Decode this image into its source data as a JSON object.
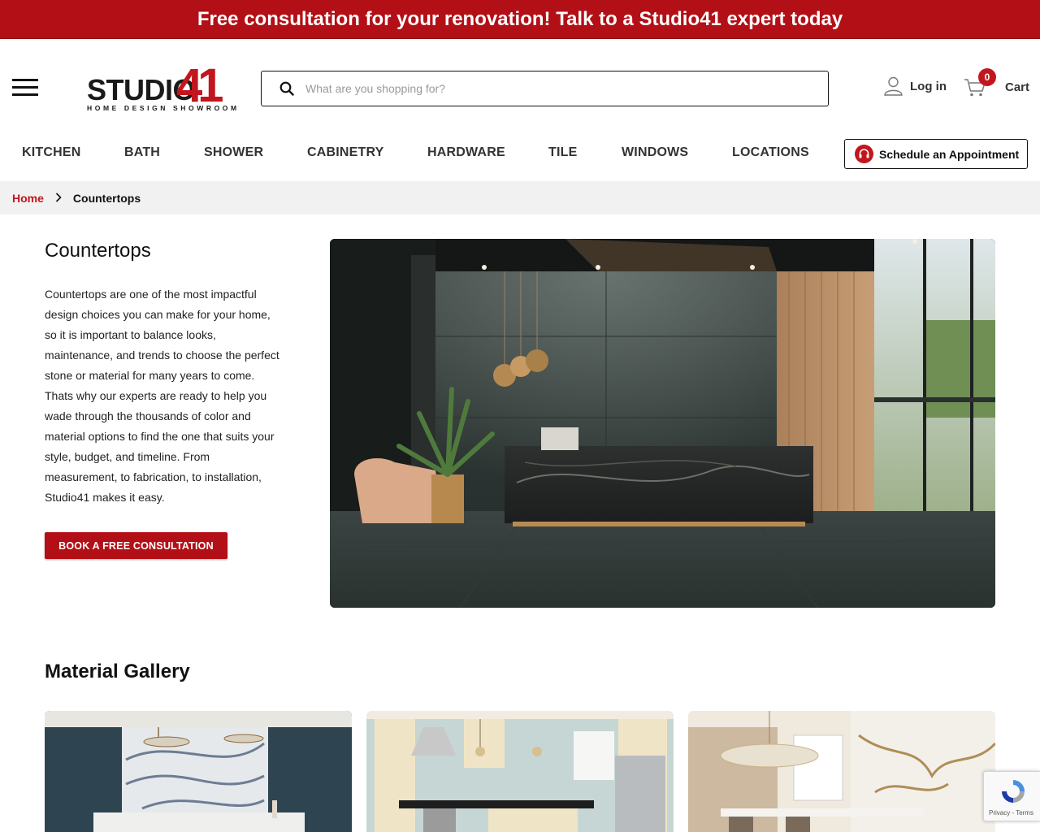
{
  "promo": {
    "text": "Free consultation for your renovation! Talk to a Studio41 expert today"
  },
  "logo": {
    "word": "STUDIO",
    "number": "41",
    "tagline": "HOME DESIGN SHOWROOM"
  },
  "search": {
    "placeholder": "What are you shopping for?",
    "value": ""
  },
  "account": {
    "login_label": "Log in"
  },
  "cart": {
    "count": "0",
    "label": "Cart"
  },
  "nav": {
    "items": [
      {
        "label": "KITCHEN"
      },
      {
        "label": "BATH"
      },
      {
        "label": "SHOWER"
      },
      {
        "label": "CABINETRY"
      },
      {
        "label": "HARDWARE"
      },
      {
        "label": "TILE"
      },
      {
        "label": "WINDOWS"
      },
      {
        "label": "LOCATIONS"
      }
    ],
    "appointment_label": "Schedule an Appointment"
  },
  "breadcrumb": {
    "home": "Home",
    "current": "Countertops"
  },
  "intro": {
    "title": "Countertops",
    "description": "Countertops are one of the most impactful design choices you can make for your home, so it is important to balance looks, maintenance, and trends to choose the perfect stone or material for many years to come. Thats why our experts are ready to help you wade through the thousands of color and material options to find the one that suits your style, budget, and timeline. From measurement, to fabrication, to installation, Studio41 makes it easy.",
    "cta_label": "BOOK A FREE CONSULTATION"
  },
  "gallery": {
    "title": "Material Gallery"
  },
  "recaptcha": {
    "links": "Privacy - Terms"
  },
  "colors": {
    "brand_red": "#b30f16",
    "logo_red": "#c2161e",
    "breadcrumb_bg": "#f1f1f1"
  },
  "icons": [
    "hamburger-icon",
    "search-icon",
    "user-icon",
    "cart-icon",
    "headset-icon",
    "chevron-right-icon",
    "recaptcha-icon"
  ]
}
